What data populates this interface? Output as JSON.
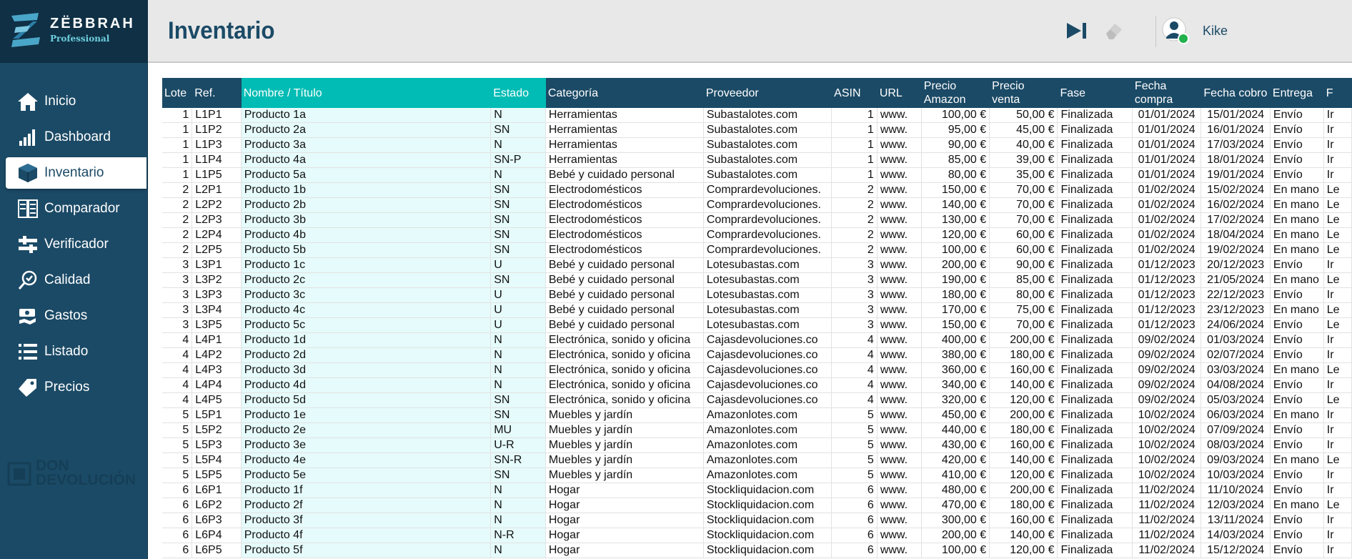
{
  "brand": {
    "name": "ZËBBRAH",
    "edition": "Professional",
    "secondary_line1": "DON",
    "secondary_line2": "DEVOLUCIÓN"
  },
  "header": {
    "title": "Inventario",
    "user": "Kike"
  },
  "colors": {
    "primary": "#1b4a66",
    "accent": "#00bcb4",
    "highlight_bg": "#e6fbfb",
    "online": "#22b14c"
  },
  "sidebar": {
    "active": "Inventario",
    "items": [
      {
        "label": "Inicio",
        "icon": "home-icon"
      },
      {
        "label": "Dashboard",
        "icon": "bar-chart-icon"
      },
      {
        "label": "Inventario",
        "icon": "box-icon"
      },
      {
        "label": "Comparador",
        "icon": "compare-icon"
      },
      {
        "label": "Verificador",
        "icon": "checker-icon"
      },
      {
        "label": "Calidad",
        "icon": "quality-badge-icon"
      },
      {
        "label": "Gastos",
        "icon": "money-icon"
      },
      {
        "label": "Listado",
        "icon": "list-icon"
      },
      {
        "label": "Precios",
        "icon": "price-tag-icon"
      }
    ]
  },
  "table": {
    "columns": [
      "Lote",
      "Ref.",
      "Nombre / Título",
      "Estado",
      "Categoría",
      "Proveedor",
      "ASIN",
      "URL",
      "Precio Amazon",
      "Precio venta",
      "Fase",
      "Fecha compra",
      "Fecha cobro",
      "Entrega",
      "F"
    ],
    "rows": [
      [
        "1",
        "L1P1",
        "Producto 1a",
        "N",
        "Herramientas",
        "Subastalotes.com",
        "1",
        "www.",
        "100,00 €",
        "50,00 €",
        "Finalizada",
        "01/01/2024",
        "15/01/2024",
        "Envío",
        "Ir"
      ],
      [
        "1",
        "L1P2",
        "Producto 2a",
        "SN",
        "Herramientas",
        "Subastalotes.com",
        "1",
        "www.",
        "95,00 €",
        "45,00 €",
        "Finalizada",
        "01/01/2024",
        "16/01/2024",
        "Envío",
        "Ir"
      ],
      [
        "1",
        "L1P3",
        "Producto 3a",
        "N",
        "Herramientas",
        "Subastalotes.com",
        "1",
        "www.",
        "90,00 €",
        "40,00 €",
        "Finalizada",
        "01/01/2024",
        "17/03/2024",
        "Envío",
        "Ir"
      ],
      [
        "1",
        "L1P4",
        "Producto 4a",
        "SN-P",
        "Herramientas",
        "Subastalotes.com",
        "1",
        "www.",
        "85,00 €",
        "39,00 €",
        "Finalizada",
        "01/01/2024",
        "18/01/2024",
        "Envío",
        "Ir"
      ],
      [
        "1",
        "L1P5",
        "Producto 5a",
        "N",
        "Bebé y cuidado personal",
        "Subastalotes.com",
        "1",
        "www.",
        "80,00 €",
        "35,00 €",
        "Finalizada",
        "01/01/2024",
        "19/01/2024",
        "Envío",
        "Ir"
      ],
      [
        "2",
        "L2P1",
        "Producto 1b",
        "SN",
        "Electrodomésticos",
        "Comprardevoluciones.",
        "2",
        "www.",
        "150,00 €",
        "70,00 €",
        "Finalizada",
        "01/02/2024",
        "15/02/2024",
        "En mano",
        "Le"
      ],
      [
        "2",
        "L2P2",
        "Producto 2b",
        "SN",
        "Electrodomésticos",
        "Comprardevoluciones.",
        "2",
        "www.",
        "140,00 €",
        "70,00 €",
        "Finalizada",
        "01/02/2024",
        "16/02/2024",
        "En mano",
        "Le"
      ],
      [
        "2",
        "L2P3",
        "Producto 3b",
        "SN",
        "Electrodomésticos",
        "Comprardevoluciones.",
        "2",
        "www.",
        "130,00 €",
        "70,00 €",
        "Finalizada",
        "01/02/2024",
        "17/02/2024",
        "En mano",
        "Le"
      ],
      [
        "2",
        "L2P4",
        "Producto 4b",
        "SN",
        "Electrodomésticos",
        "Comprardevoluciones.",
        "2",
        "www.",
        "120,00 €",
        "60,00 €",
        "Finalizada",
        "01/02/2024",
        "18/04/2024",
        "En mano",
        "Le"
      ],
      [
        "2",
        "L2P5",
        "Producto 5b",
        "SN",
        "Electrodomésticos",
        "Comprardevoluciones.",
        "2",
        "www.",
        "100,00 €",
        "60,00 €",
        "Finalizada",
        "01/02/2024",
        "19/02/2024",
        "En mano",
        "Le"
      ],
      [
        "3",
        "L3P1",
        "Producto 1c",
        "U",
        "Bebé y cuidado personal",
        "Lotesubastas.com",
        "3",
        "www.",
        "200,00 €",
        "90,00 €",
        "Finalizada",
        "01/12/2023",
        "20/12/2023",
        "Envío",
        "Ir"
      ],
      [
        "3",
        "L3P2",
        "Producto 2c",
        "SN",
        "Bebé y cuidado personal",
        "Lotesubastas.com",
        "3",
        "www.",
        "190,00 €",
        "85,00 €",
        "Finalizada",
        "01/12/2023",
        "21/05/2024",
        "En mano",
        "Le"
      ],
      [
        "3",
        "L3P3",
        "Producto 3c",
        "U",
        "Bebé y cuidado personal",
        "Lotesubastas.com",
        "3",
        "www.",
        "180,00 €",
        "80,00 €",
        "Finalizada",
        "01/12/2023",
        "22/12/2023",
        "Envío",
        "Ir"
      ],
      [
        "3",
        "L3P4",
        "Producto 4c",
        "U",
        "Bebé y cuidado personal",
        "Lotesubastas.com",
        "3",
        "www.",
        "170,00 €",
        "75,00 €",
        "Finalizada",
        "01/12/2023",
        "23/12/2023",
        "En mano",
        "Le"
      ],
      [
        "3",
        "L3P5",
        "Producto 5c",
        "U",
        "Bebé y cuidado personal",
        "Lotesubastas.com",
        "3",
        "www.",
        "150,00 €",
        "70,00 €",
        "Finalizada",
        "01/12/2023",
        "24/06/2024",
        "Envío",
        "Le"
      ],
      [
        "4",
        "L4P1",
        "Producto 1d",
        "N",
        "Electrónica, sonido y oficina",
        "Cajasdevoluciones.co",
        "4",
        "www.",
        "400,00 €",
        "200,00 €",
        "Finalizada",
        "09/02/2024",
        "01/03/2024",
        "Envío",
        "Ir"
      ],
      [
        "4",
        "L4P2",
        "Producto 2d",
        "N",
        "Electrónica, sonido y oficina",
        "Cajasdevoluciones.co",
        "4",
        "www.",
        "380,00 €",
        "180,00 €",
        "Finalizada",
        "09/02/2024",
        "02/07/2024",
        "Envío",
        "Ir"
      ],
      [
        "4",
        "L4P3",
        "Producto 3d",
        "N",
        "Electrónica, sonido y oficina",
        "Cajasdevoluciones.co",
        "4",
        "www.",
        "360,00 €",
        "160,00 €",
        "Finalizada",
        "09/02/2024",
        "03/03/2024",
        "En mano",
        "Le"
      ],
      [
        "4",
        "L4P4",
        "Producto 4d",
        "N",
        "Electrónica, sonido y oficina",
        "Cajasdevoluciones.co",
        "4",
        "www.",
        "340,00 €",
        "140,00 €",
        "Finalizada",
        "09/02/2024",
        "04/08/2024",
        "Envío",
        "Ir"
      ],
      [
        "4",
        "L4P5",
        "Producto 5d",
        "SN",
        "Electrónica, sonido y oficina",
        "Cajasdevoluciones.co",
        "4",
        "www.",
        "320,00 €",
        "120,00 €",
        "Finalizada",
        "09/02/2024",
        "05/03/2024",
        "Envío",
        "Le"
      ],
      [
        "5",
        "L5P1",
        "Producto 1e",
        "SN",
        "Muebles y jardín",
        "Amazonlotes.com",
        "5",
        "www.",
        "450,00 €",
        "200,00 €",
        "Finalizada",
        "10/02/2024",
        "06/03/2024",
        "En mano",
        "Ir"
      ],
      [
        "5",
        "L5P2",
        "Producto 2e",
        "MU",
        "Muebles y jardín",
        "Amazonlotes.com",
        "5",
        "www.",
        "440,00 €",
        "180,00 €",
        "Finalizada",
        "10/02/2024",
        "07/09/2024",
        "Envío",
        "Ir"
      ],
      [
        "5",
        "L5P3",
        "Producto 3e",
        "U-R",
        "Muebles y jardín",
        "Amazonlotes.com",
        "5",
        "www.",
        "430,00 €",
        "160,00 €",
        "Finalizada",
        "10/02/2024",
        "08/03/2024",
        "Envío",
        "Ir"
      ],
      [
        "5",
        "L5P4",
        "Producto 4e",
        "SN-R",
        "Muebles y jardín",
        "Amazonlotes.com",
        "5",
        "www.",
        "420,00 €",
        "140,00 €",
        "Finalizada",
        "10/02/2024",
        "09/03/2024",
        "En mano",
        "Le"
      ],
      [
        "5",
        "L5P5",
        "Producto 5e",
        "SN",
        "Muebles y jardín",
        "Amazonlotes.com",
        "5",
        "www.",
        "410,00 €",
        "120,00 €",
        "Finalizada",
        "10/02/2024",
        "10/03/2024",
        "Envío",
        "Ir"
      ],
      [
        "6",
        "L6P1",
        "Producto 1f",
        "N",
        "Hogar",
        "Stockliquidacion.com",
        "6",
        "www.",
        "480,00 €",
        "200,00 €",
        "Finalizada",
        "11/02/2024",
        "11/10/2024",
        "Envío",
        "Ir"
      ],
      [
        "6",
        "L6P2",
        "Producto 2f",
        "N",
        "Hogar",
        "Stockliquidacion.com",
        "6",
        "www.",
        "470,00 €",
        "180,00 €",
        "Finalizada",
        "11/02/2024",
        "12/03/2024",
        "En mano",
        "Le"
      ],
      [
        "6",
        "L6P3",
        "Producto 3f",
        "N",
        "Hogar",
        "Stockliquidacion.com",
        "6",
        "www.",
        "300,00 €",
        "160,00 €",
        "Finalizada",
        "11/02/2024",
        "13/11/2024",
        "Envío",
        "Ir"
      ],
      [
        "6",
        "L6P4",
        "Producto 4f",
        "N-R",
        "Hogar",
        "Stockliquidacion.com",
        "6",
        "www.",
        "200,00 €",
        "140,00 €",
        "Finalizada",
        "11/02/2024",
        "14/03/2024",
        "Envío",
        "Ir"
      ],
      [
        "6",
        "L6P5",
        "Producto 5f",
        "N",
        "Hogar",
        "Stockliquidacion.com",
        "6",
        "www.",
        "100,00 €",
        "120,00 €",
        "Finalizada",
        "11/02/2024",
        "15/12/2024",
        "Envío",
        "Ir"
      ]
    ]
  }
}
